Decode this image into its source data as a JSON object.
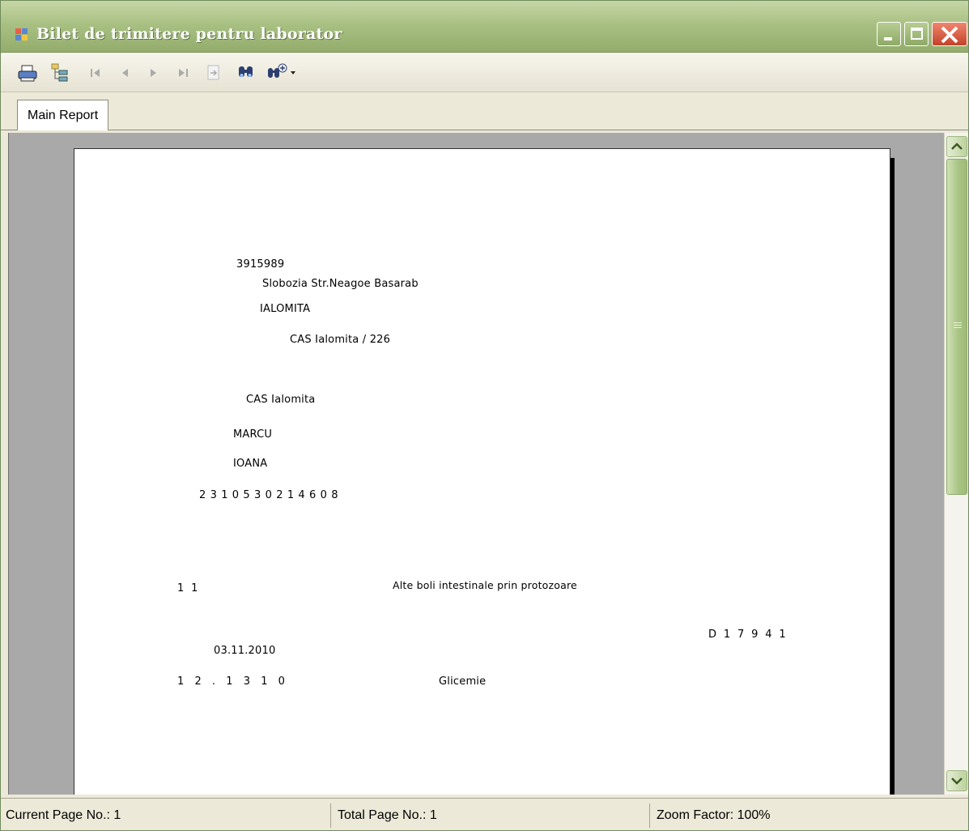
{
  "window": {
    "title": "Bilet de trimitere pentru laborator",
    "title_color": "#ffffff",
    "frame_color": "#93ad6c"
  },
  "toolbar": {
    "buttons": [
      {
        "name": "print-icon",
        "enabled": true
      },
      {
        "name": "group-tree-icon",
        "enabled": true
      },
      {
        "name": "first-page-icon",
        "enabled": false
      },
      {
        "name": "previous-page-icon",
        "enabled": false
      },
      {
        "name": "next-page-icon",
        "enabled": false
      },
      {
        "name": "last-page-icon",
        "enabled": false
      },
      {
        "name": "goto-page-icon",
        "enabled": false
      },
      {
        "name": "find-icon",
        "enabled": true
      },
      {
        "name": "zoom-icon",
        "enabled": true
      }
    ]
  },
  "tabs": [
    {
      "label": "Main Report",
      "active": true
    }
  ],
  "report": {
    "code": "3915989",
    "address": "Slobozia Str.Neagoe Basarab",
    "county": "IALOMITA",
    "cas_contract": "CAS Ialomita / 226",
    "cas": "CAS Ialomita",
    "last_name": "MARCU",
    "first_name": "IOANA",
    "cnp": "2 3 1 0 5 3 0 2 1 4 6 0 8",
    "diag_code": "1  1",
    "diagnosis": "Alte boli intestinale prin protozoare",
    "doctor_code": "D  1  7  9  4  1",
    "date": "03.11.2010",
    "analysis_code": "1   2   .   1   3   1   0",
    "analysis_name": "Glicemie"
  },
  "status": {
    "current_page": "Current Page No.: 1",
    "total_pages": "Total Page No.: 1",
    "zoom": "Zoom Factor: 100%"
  }
}
